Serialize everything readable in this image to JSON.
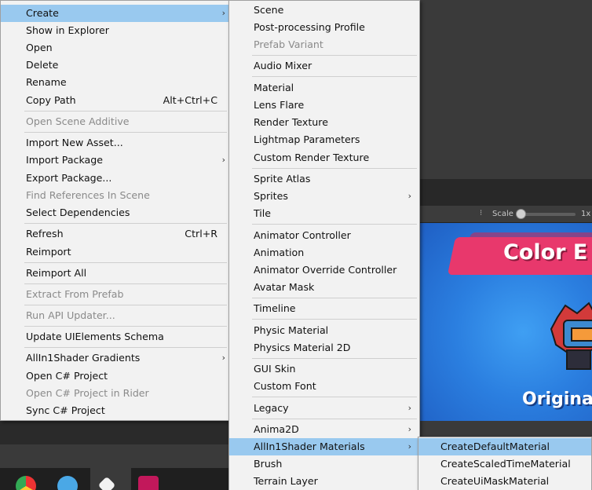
{
  "context_menu": {
    "items": [
      {
        "label": "Create",
        "arrow": "›",
        "highlighted": true
      },
      {
        "label": "Show in Explorer"
      },
      {
        "label": "Open"
      },
      {
        "label": "Delete"
      },
      {
        "label": "Rename"
      },
      {
        "label": "Copy Path",
        "shortcut": "Alt+Ctrl+C"
      },
      {
        "label": "Open Scene Additive",
        "disabled": true
      },
      {
        "label": "Import New Asset..."
      },
      {
        "label": "Import Package",
        "arrow": "›"
      },
      {
        "label": "Export Package..."
      },
      {
        "label": "Find References In Scene",
        "disabled": true
      },
      {
        "label": "Select Dependencies"
      },
      {
        "label": "Refresh",
        "shortcut": "Ctrl+R"
      },
      {
        "label": "Reimport"
      },
      {
        "label": "Reimport All"
      },
      {
        "label": "Extract From Prefab",
        "disabled": true
      },
      {
        "label": "Run API Updater...",
        "disabled": true
      },
      {
        "label": "Update UIElements Schema"
      },
      {
        "label": "AllIn1Shader Gradients",
        "arrow": "›"
      },
      {
        "label": "Open C# Project"
      },
      {
        "label": "Open C# Project in Rider",
        "disabled": true
      },
      {
        "label": "Sync C# Project"
      }
    ]
  },
  "create_submenu": {
    "items": [
      {
        "label": "Scene"
      },
      {
        "label": "Post-processing Profile"
      },
      {
        "label": "Prefab Variant",
        "disabled": true
      },
      {
        "label": "Audio Mixer"
      },
      {
        "label": "Material"
      },
      {
        "label": "Lens Flare"
      },
      {
        "label": "Render Texture"
      },
      {
        "label": "Lightmap Parameters"
      },
      {
        "label": "Custom Render Texture"
      },
      {
        "label": "Sprite Atlas"
      },
      {
        "label": "Sprites",
        "arrow": "›"
      },
      {
        "label": "Tile"
      },
      {
        "label": "Animator Controller"
      },
      {
        "label": "Animation"
      },
      {
        "label": "Animator Override Controller"
      },
      {
        "label": "Avatar Mask"
      },
      {
        "label": "Timeline"
      },
      {
        "label": "Physic Material"
      },
      {
        "label": "Physics Material 2D"
      },
      {
        "label": "GUI Skin"
      },
      {
        "label": "Custom Font"
      },
      {
        "label": "Legacy",
        "arrow": "›"
      },
      {
        "label": "Anima2D",
        "arrow": "›"
      },
      {
        "label": "AllIn1Shader Materials",
        "arrow": "›",
        "highlighted": true
      },
      {
        "label": "Brush"
      },
      {
        "label": "Terrain Layer"
      }
    ]
  },
  "materials_submenu": {
    "items": [
      {
        "label": "CreateDefaultMaterial",
        "highlighted": true
      },
      {
        "label": "CreateScaledTimeMaterial"
      },
      {
        "label": "CreateUiMaskMaterial"
      }
    ]
  },
  "scene_toolbar": {
    "scale_label": "Scale",
    "zoom_label": "1x"
  },
  "game_view": {
    "title_text": "Color E",
    "subtitle_text": "Original"
  },
  "colors": {
    "menu_bg": "#f2f2f2",
    "highlight": "#99c9ef",
    "disabled_text": "#8a8a8a",
    "game_banner": "#e8386c",
    "game_bg": "#2b7fe0"
  }
}
